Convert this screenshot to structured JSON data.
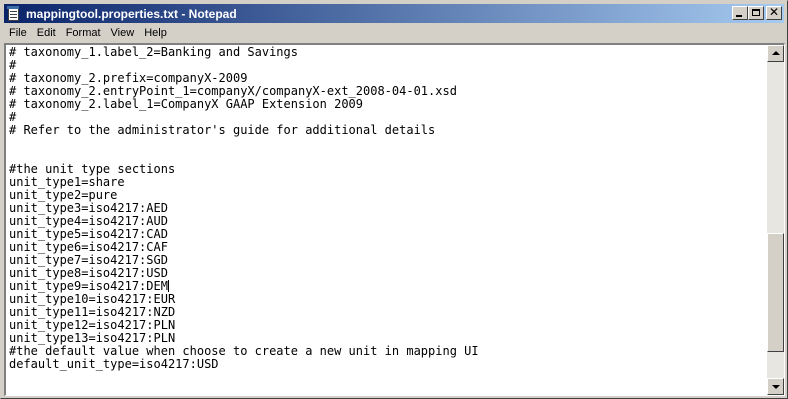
{
  "window": {
    "title": "mappingtool.properties.txt - Notepad",
    "controls": {
      "minimize_icon": "minimize-icon",
      "maximize_icon": "maximize-icon",
      "close_icon": "close-icon"
    }
  },
  "menu": [
    "File",
    "Edit",
    "Format",
    "View",
    "Help"
  ],
  "editor": {
    "lines": [
      "# taxonomy_1.label_2=Banking and Savings",
      "#",
      "# taxonomy_2.prefix=companyX-2009",
      "# taxonomy_2.entryPoint_1=companyX/companyX-ext_2008-04-01.xsd",
      "# taxonomy_2.label_1=CompanyX GAAP Extension 2009",
      "#",
      "# Refer to the administrator's guide for additional details",
      "",
      "",
      "#the unit type sections",
      "unit_type1=share",
      "unit_type2=pure",
      "unit_type3=iso4217:AED",
      "unit_type4=iso4217:AUD",
      "unit_type5=iso4217:CAD",
      "unit_type6=iso4217:CAF",
      "unit_type7=iso4217:SGD",
      "unit_type8=iso4217:USD",
      "unit_type9=iso4217:DEM",
      "unit_type10=iso4217:EUR",
      "unit_type11=iso4217:NZD",
      "unit_type12=iso4217:PLN",
      "unit_type13=iso4217:PLN",
      "#the default value when choose to create a new unit in mapping UI",
      "default_unit_type=iso4217:USD"
    ],
    "caret_line": 18
  },
  "scrollbar": {
    "position": 0.87
  },
  "colors": {
    "titlebar_start": "#0a246a",
    "titlebar_end": "#a6caf0",
    "face": "#d4d0c8"
  }
}
